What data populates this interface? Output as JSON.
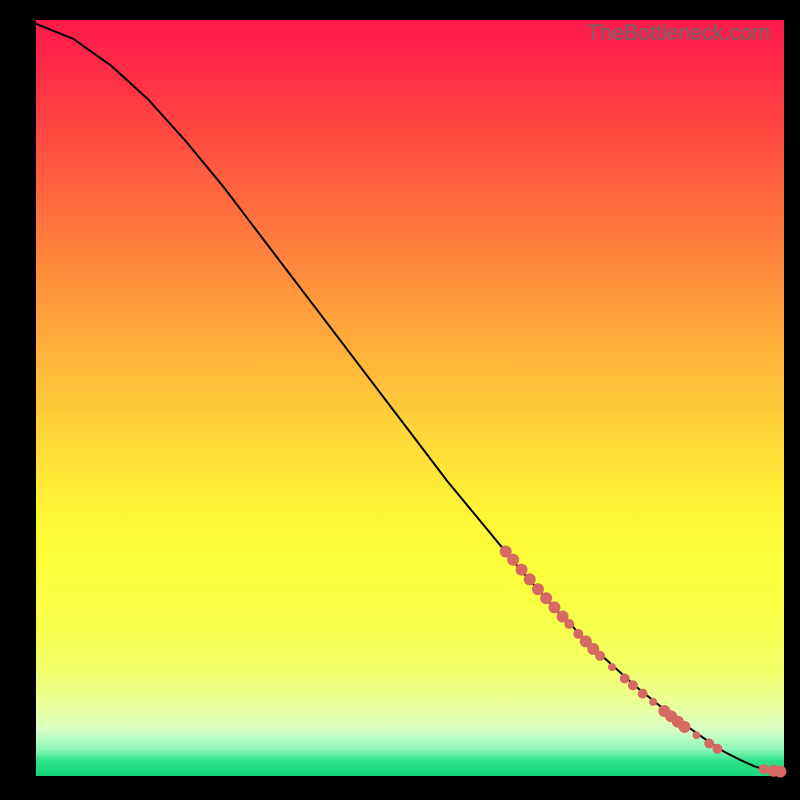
{
  "watermark": "TheBottleneck.com",
  "colors": {
    "point": "#d66a63",
    "line": "#000000",
    "background": "#000000"
  },
  "chart_data": {
    "type": "line",
    "title": "",
    "xlabel": "",
    "ylabel": "",
    "xlim": [
      0,
      100
    ],
    "ylim": [
      0,
      100
    ],
    "grid": false,
    "legend": false,
    "curve": {
      "comment": "Smooth monotone decreasing curve from top-left to bottom-right, flattening near y≈0 at the end",
      "x": [
        0,
        5,
        10,
        15,
        20,
        25,
        30,
        35,
        40,
        45,
        50,
        55,
        60,
        65,
        70,
        75,
        80,
        85,
        90,
        92,
        94,
        96,
        98,
        100
      ],
      "y": [
        99.5,
        97.5,
        94.0,
        89.5,
        84.0,
        78.0,
        71.5,
        65.0,
        58.5,
        52.0,
        45.5,
        39.0,
        33.0,
        27.0,
        21.5,
        16.5,
        12.0,
        8.0,
        4.5,
        3.2,
        2.2,
        1.3,
        0.7,
        0.6
      ]
    },
    "scatter_points": {
      "comment": "Dense salmon markers along the lower-right segment of the curve",
      "points": [
        {
          "x": 62.8,
          "y": 29.7,
          "r": 6
        },
        {
          "x": 63.8,
          "y": 28.6,
          "r": 6
        },
        {
          "x": 64.9,
          "y": 27.3,
          "r": 6
        },
        {
          "x": 66.0,
          "y": 26.0,
          "r": 6
        },
        {
          "x": 67.1,
          "y": 24.7,
          "r": 6
        },
        {
          "x": 68.2,
          "y": 23.5,
          "r": 6
        },
        {
          "x": 69.3,
          "y": 22.3,
          "r": 6
        },
        {
          "x": 70.4,
          "y": 21.1,
          "r": 6
        },
        {
          "x": 71.3,
          "y": 20.1,
          "r": 5
        },
        {
          "x": 72.5,
          "y": 18.8,
          "r": 5
        },
        {
          "x": 73.5,
          "y": 17.8,
          "r": 6
        },
        {
          "x": 74.5,
          "y": 16.8,
          "r": 6
        },
        {
          "x": 75.4,
          "y": 15.9,
          "r": 5
        },
        {
          "x": 77.0,
          "y": 14.4,
          "r": 4
        },
        {
          "x": 78.7,
          "y": 12.9,
          "r": 5
        },
        {
          "x": 79.8,
          "y": 12.0,
          "r": 5
        },
        {
          "x": 81.1,
          "y": 10.9,
          "r": 5
        },
        {
          "x": 82.5,
          "y": 9.8,
          "r": 4
        },
        {
          "x": 84.0,
          "y": 8.6,
          "r": 6
        },
        {
          "x": 84.9,
          "y": 7.9,
          "r": 6
        },
        {
          "x": 85.8,
          "y": 7.2,
          "r": 6
        },
        {
          "x": 86.7,
          "y": 6.5,
          "r": 6
        },
        {
          "x": 88.3,
          "y": 5.4,
          "r": 4
        },
        {
          "x": 90.0,
          "y": 4.3,
          "r": 5
        },
        {
          "x": 91.1,
          "y": 3.6,
          "r": 5
        },
        {
          "x": 97.3,
          "y": 0.9,
          "r": 5
        },
        {
          "x": 98.6,
          "y": 0.7,
          "r": 6
        },
        {
          "x": 99.5,
          "y": 0.6,
          "r": 6
        }
      ]
    }
  }
}
